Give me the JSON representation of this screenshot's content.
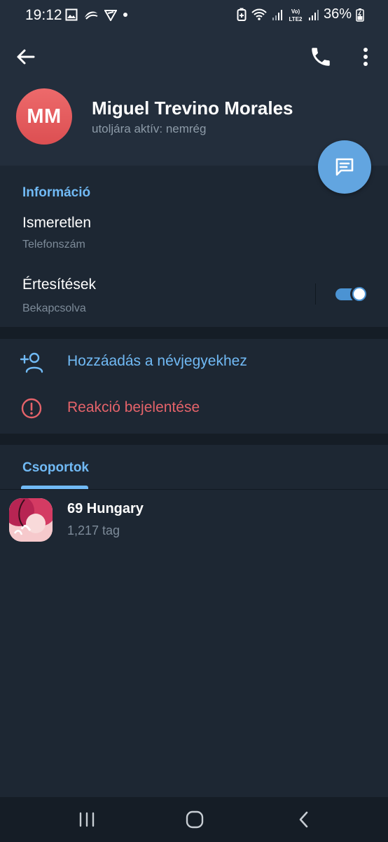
{
  "status_bar": {
    "time": "19:12",
    "battery": "36%",
    "network": "LTE2"
  },
  "header": {
    "avatar_initials": "MM",
    "name": "Miguel Trevino Morales",
    "status": "utoljára aktív: nemrég"
  },
  "info": {
    "section_title": "Információ",
    "phone_value": "Ismeretlen",
    "phone_label": "Telefonszám",
    "notifications_value": "Értesítések",
    "notifications_label": "Bekapcsolva",
    "notifications_on": true
  },
  "actions": {
    "add_contact": "Hozzáadás a névjegyekhez",
    "report": "Reakció bejelentése"
  },
  "groups": {
    "tab_label": "Csoportok",
    "items": [
      {
        "name": "69 Hungary",
        "members": "1,217 tag"
      }
    ]
  },
  "colors": {
    "accent": "#71baf5",
    "danger": "#e5636a",
    "background": "#1d2733",
    "header": "#232e3c",
    "fab": "#62a5e0",
    "avatar": "#e05a5c"
  }
}
